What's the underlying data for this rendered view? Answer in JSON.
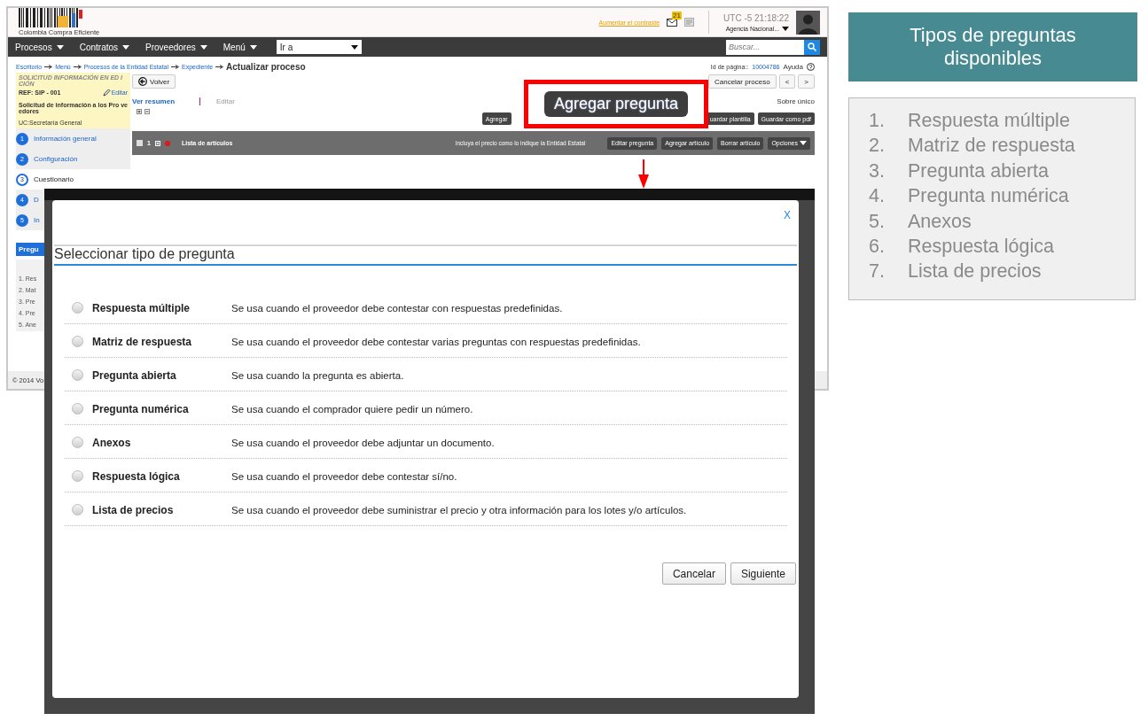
{
  "app_screenshot": {
    "header": {
      "logo_text": "Colombia Compra Eficiente",
      "contrast_link": "Aumentar el contraste",
      "mail_count": "21",
      "clock": "UTC -5 21:18:22",
      "agency": "Agencia Nacional..."
    },
    "nav": {
      "items": [
        "Procesos",
        "Contratos",
        "Proveedores",
        "Menú"
      ],
      "goto": "Ir a",
      "search_placeholder": "Buscar..."
    },
    "breadcrumb": [
      "Escritorio",
      "Menú",
      "Procesos de la Entidad Estatal",
      "Expediente"
    ],
    "page_title": "Actualizar proceso",
    "page_id_label": "Id de página::",
    "page_id": "10004786",
    "help": "Ayuda",
    "process_card": {
      "status": "SOLICITUD INFORMACIÓN EN ED ICIÓN",
      "ref": "REF: SIP - 001",
      "edit": "Editar",
      "name": "Solicitud de información a los Pro veedores",
      "unit": "UC:Secretaría General"
    },
    "steps": [
      {
        "number": "1",
        "label": "Información general",
        "current": false
      },
      {
        "number": "2",
        "label": "Configuración",
        "current": false
      },
      {
        "number": "3",
        "label": "Cuestionario",
        "current": true
      },
      {
        "number": "4",
        "label": "D",
        "current": false
      },
      {
        "number": "5",
        "label": "In",
        "current": false
      }
    ],
    "questions_header": "Pregu",
    "questions": [
      "1. Res",
      "2. Mat",
      "3. Pre",
      "4. Pre",
      "5. Ane"
    ],
    "back_button": "Volver",
    "cancel_button": "Cancelar proceso",
    "prev_button": "<",
    "next_button": ">",
    "view_links": [
      {
        "label": "Ver resumen",
        "disabled": false
      },
      {
        "label": "Editar",
        "disabled": true
      }
    ],
    "envelope": "Sobre único",
    "toolbar": [
      "Agregar",
      "uardar plantilla",
      "Guardar como pdf"
    ],
    "item_bar": {
      "checked": false,
      "count": "1",
      "title": "Lista de artículos",
      "hint": "Incluya el precio como lo indique la Entidad Estatal",
      "buttons": [
        "Editar pregunta",
        "Agregar artículo",
        "Borrar artículo"
      ],
      "options": "Opciones"
    },
    "footer": "© 2014 Vo"
  },
  "dialog": {
    "close": "X",
    "title": "Seleccionar tipo de pregunta",
    "options": [
      {
        "label": "Respuesta múltiple",
        "description": "Se usa cuando el proveedor debe contestar con respuestas predefinidas.",
        "selected": false
      },
      {
        "label": "Matriz de respuesta",
        "description": "Se usa cuando el proveedor debe contestar varias preguntas con respuestas predefinidas.",
        "selected": false
      },
      {
        "label": "Pregunta abierta",
        "description": "Se usa cuando la pregunta es abierta.",
        "selected": false
      },
      {
        "label": "Pregunta numérica",
        "description": "Se usa cuando el comprador quiere pedir un número.",
        "selected": false
      },
      {
        "label": "Anexos",
        "description": "Se usa cuando el proveedor debe adjuntar un documento.",
        "selected": false
      },
      {
        "label": "Respuesta lógica",
        "description": "Se usa cuando el proveedor debe contestar sí/no.",
        "selected": false
      },
      {
        "label": "Lista de precios",
        "description": "Se usa cuando el proveedor debe suministrar el precio y otra información para los lotes y/o artículos.",
        "selected": false
      }
    ],
    "buttons": [
      "Cancelar",
      "Siguiente"
    ]
  },
  "callout": {
    "label": "Agregar pregunta"
  },
  "side_panel": {
    "title": "Tipos de preguntas disponibles",
    "items": [
      {
        "number": "1.",
        "label": "Respuesta múltiple"
      },
      {
        "number": "2.",
        "label": "Matriz de respuesta"
      },
      {
        "number": "3.",
        "label": "Pregunta abierta"
      },
      {
        "number": "4.",
        "label": "Pregunta numérica"
      },
      {
        "number": "5.",
        "label": "Anexos"
      },
      {
        "number": "6.",
        "label": "Respuesta lógica"
      },
      {
        "number": "7.",
        "label": "Lista de precios"
      }
    ]
  }
}
